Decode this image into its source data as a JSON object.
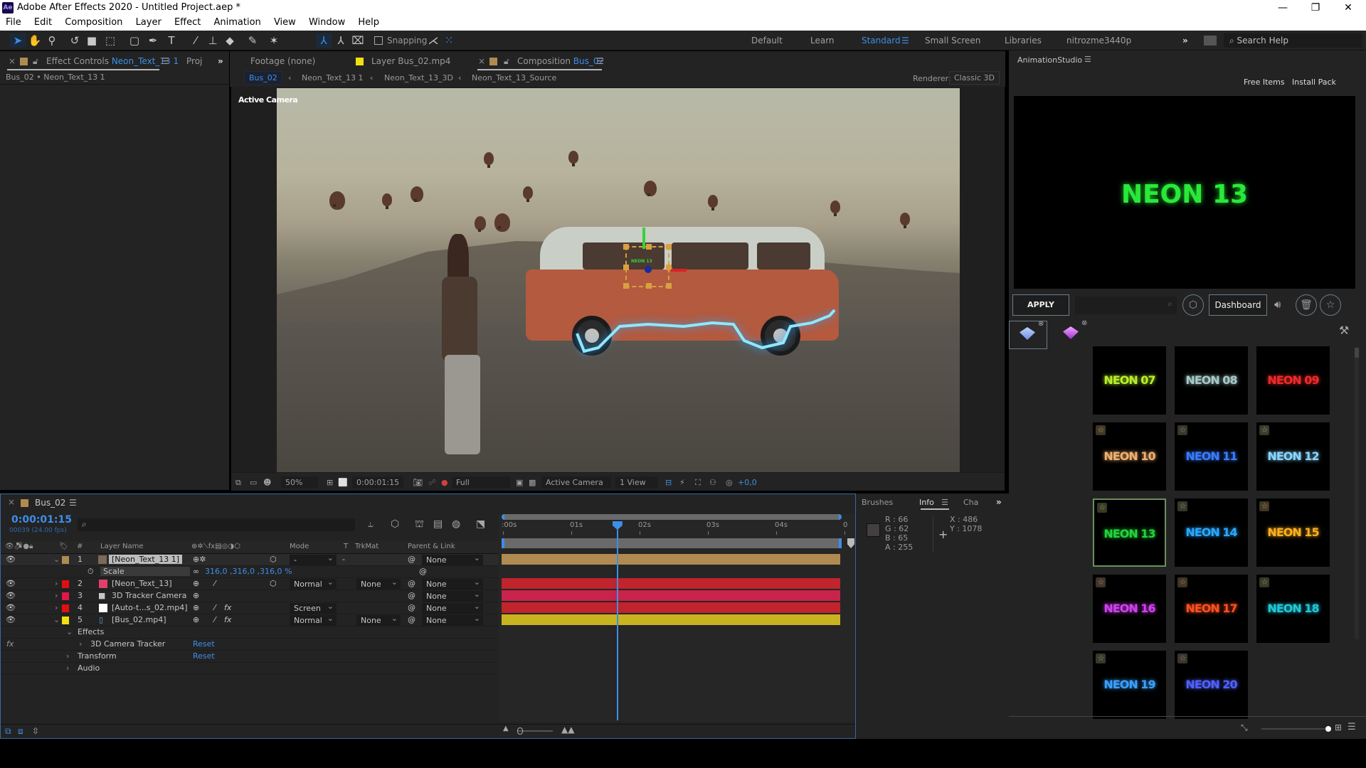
{
  "window": {
    "app_icon": "Ae",
    "title": "Adobe After Effects 2020 - Untitled Project.aep *",
    "controls": {
      "minimize": "—",
      "restore": "❐",
      "close": "✕"
    }
  },
  "menu": [
    "File",
    "Edit",
    "Composition",
    "Layer",
    "Effect",
    "Animation",
    "View",
    "Window",
    "Help"
  ],
  "toolbar": {
    "snapping_label": "Snapping",
    "workspaces": [
      "Default",
      "Learn",
      "Standard",
      "Small Screen",
      "Libraries",
      "nitrozme3440p"
    ],
    "active_workspace": "Standard",
    "overflow": "»",
    "search_help_placeholder": "Search Help"
  },
  "left_panel": {
    "tab_effect_controls": "Effect Controls",
    "tab_effect_controls_target": "Neon_Text_13 1",
    "tab_project": "Proj",
    "overflow": "»",
    "breadcrumb": "Bus_02 • Neon_Text_13 1"
  },
  "viewer": {
    "tab_footage": "Footage (none)",
    "tab_layer": "Layer  Bus_02.mp4",
    "tab_composition": "Composition",
    "tab_composition_target": "Bus_02",
    "flowchart": [
      "Bus_02",
      "Neon_Text_13 1",
      "Neon_Text_13_3D",
      "Neon_Text_13_Source"
    ],
    "renderer_label": "Renderer:",
    "renderer_value": "Classic 3D",
    "camera_label": "Active Camera",
    "gizmo_text": "NEON 13",
    "bottom_bar": {
      "zoom": "50%",
      "timecode": "0:00:01:15",
      "resolution": "Full",
      "camera": "Active Camera",
      "views": "1 View",
      "exposure": "+0,0"
    }
  },
  "timeline": {
    "comp_tab": "Bus_02",
    "current_time": "0:00:01:15",
    "frame_info": "00039 (24.00 fps)",
    "search_placeholder": "",
    "columns": {
      "number": "#",
      "layer_name": "Layer Name",
      "mode": "Mode",
      "t": "T",
      "trkmat": "TrkMat",
      "parent": "Parent & Link"
    },
    "layers": [
      {
        "num": "1",
        "name": "[Neon_Text_13 1]",
        "label_color": "#b08a50",
        "mode": "-",
        "trkmat": "",
        "parent": "None",
        "expanded": true,
        "selected": true
      },
      {
        "num": "2",
        "name": "[Neon_Text_13]",
        "label_color": "#e01010",
        "mode": "Normal",
        "trkmat": "None",
        "parent": "None"
      },
      {
        "num": "3",
        "name": "3D Tracker Camera",
        "label_color": "#e0184a",
        "mode": "",
        "trkmat": "",
        "parent": "None"
      },
      {
        "num": "4",
        "name": "[Auto-t...s_02.mp4]",
        "label_color": "#e01010",
        "mode": "Screen",
        "trkmat": "",
        "parent": "None"
      },
      {
        "num": "5",
        "name": "[Bus_02.mp4]",
        "label_color": "#f0e010",
        "mode": "Normal",
        "trkmat": "None",
        "parent": "None",
        "expanded": true
      }
    ],
    "property_scale": {
      "name": "Scale",
      "value": "316,0 ,316,0 ,316,0 %"
    },
    "effects_group": "Effects",
    "sub_items": [
      {
        "name": "3D Camera Tracker",
        "action": "Reset"
      },
      {
        "name": "Transform",
        "action": "Reset"
      },
      {
        "name": "Audio",
        "action": ""
      }
    ],
    "ruler_ticks": [
      ":00s",
      "01s",
      "02s",
      "03s",
      "04s",
      "0"
    ],
    "playhead_fraction": 0.34,
    "bar_colors": {
      "layer1": "#b08a50",
      "layer2": "#c0242c",
      "layer3": "#c8234a",
      "layer4": "#c0242c",
      "layer5": "#c8b420"
    }
  },
  "info_panel": {
    "tabs": [
      "Brushes",
      "Info",
      "Cha"
    ],
    "active_tab": "Info",
    "overflow": "»",
    "r": "R : 66",
    "g": "G : 62",
    "b": "B : 65",
    "a": "A : 255",
    "x": "X : 486",
    "y": "Y : 1078"
  },
  "animation_studio": {
    "title": "AnimationStudio",
    "free_items": "Free Items",
    "install_pack": "Install Pack",
    "preview_text": "NEON 13",
    "apply": "APPLY",
    "search_placeholder": "",
    "dashboard": "Dashboard",
    "presets": [
      {
        "label": "NEON 07",
        "color": "#b6f02a",
        "star": false
      },
      {
        "label": "NEON 08",
        "color": "#a8c8c8",
        "star": false
      },
      {
        "label": "NEON 09",
        "color": "#f02a2a",
        "star": false
      },
      {
        "label": "NEON 10",
        "color": "#f0b070",
        "star": true
      },
      {
        "label": "NEON 11",
        "color": "#3a7cff",
        "star": true
      },
      {
        "label": "NEON 12",
        "color": "#8ad6ff",
        "star": true
      },
      {
        "label": "NEON 13",
        "color": "#22d43a",
        "star": true,
        "selected": true
      },
      {
        "label": "NEON 14",
        "color": "#2aa8ff",
        "star": true
      },
      {
        "label": "NEON 15",
        "color": "#ffb020",
        "star": true
      },
      {
        "label": "NEON 16",
        "color": "#d040f0",
        "star": true
      },
      {
        "label": "NEON 17",
        "color": "#ff5020",
        "star": true
      },
      {
        "label": "NEON 18",
        "color": "#20c8d8",
        "star": true
      },
      {
        "label": "NEON 19",
        "color": "#3aa0ff",
        "star": true
      },
      {
        "label": "NEON 20",
        "color": "#5060ff",
        "star": true
      }
    ]
  },
  "colors": {
    "accent": "#3d8ee8",
    "panel": "#232323",
    "selected_preset_border": "#6a8f5a"
  }
}
